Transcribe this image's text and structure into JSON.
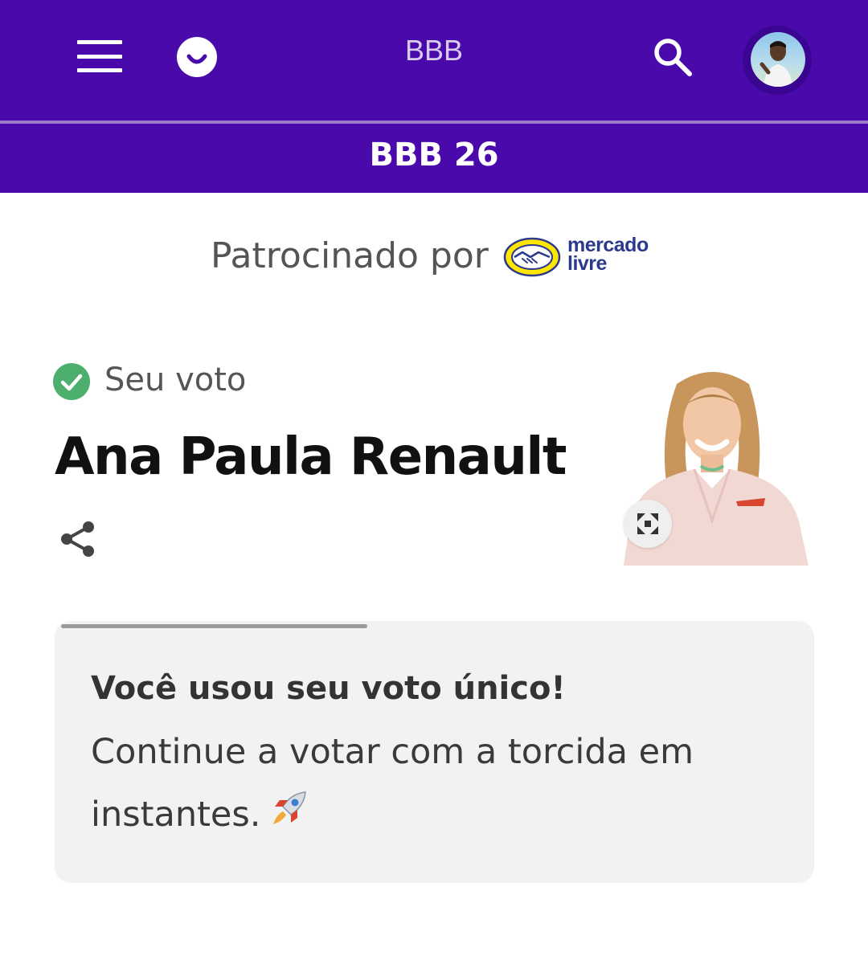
{
  "header": {
    "app_title": "BBB",
    "menu_icon": "hamburger-menu-icon",
    "brand_icon": "smile-icon",
    "search_icon": "search-icon",
    "avatar": "user-avatar"
  },
  "subheader": {
    "season_title": "BBB 26"
  },
  "sponsor": {
    "label": "Patrocinado por",
    "brand_line1": "mercado",
    "brand_line2": "livre"
  },
  "vote": {
    "status_label": "Seu voto",
    "participant_name": "Ana Paula Renault",
    "share_icon": "share-icon",
    "expand_icon": "expand-icon"
  },
  "notice": {
    "title": "Você usou seu voto único!",
    "body": "Continue a votar com a torcida em instantes.",
    "emoji_icon": "rocket-icon",
    "progress": 0.41
  },
  "colors": {
    "brand_purple": "#4a0aab",
    "check_green": "#4caf6e",
    "card_bg": "#f2f2f2"
  }
}
